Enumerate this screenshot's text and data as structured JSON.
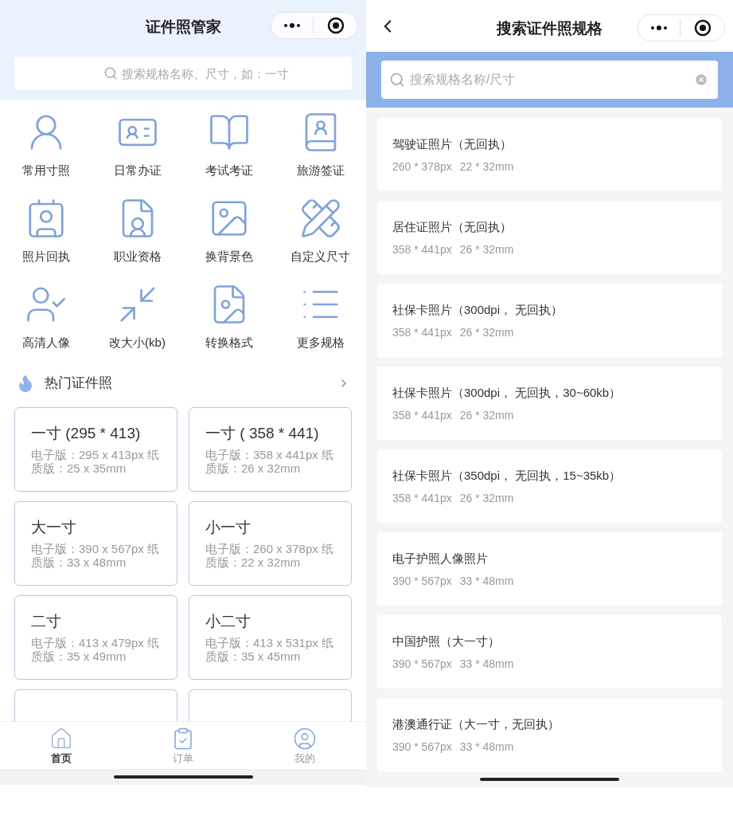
{
  "left": {
    "title": "证件照管家",
    "search": {
      "placeholder": "搜索规格名称、尺寸，如：一寸"
    },
    "shortcuts": [
      {
        "label": "常用寸照"
      },
      {
        "label": "日常办证"
      },
      {
        "label": "考试考证"
      },
      {
        "label": "旅游签证"
      },
      {
        "label": "照片回执"
      },
      {
        "label": "职业资格"
      },
      {
        "label": "换背景色"
      },
      {
        "label": "自定义尺寸"
      },
      {
        "label": "高清人像"
      },
      {
        "label": "改大小(kb)"
      },
      {
        "label": "转换格式"
      },
      {
        "label": "更多规格"
      }
    ],
    "hot": {
      "title": "热门证件照",
      "cards": [
        {
          "title": "一寸 (295 * 413)",
          "detail": "电子版：295 x 413px 纸质版：25 x 35mm"
        },
        {
          "title": "一寸 ( 358 * 441)",
          "detail": "电子版：358 x 441px 纸质版：26 x 32mm"
        },
        {
          "title": "大一寸",
          "detail": "电子版：390 x 567px 纸质版：33 x 48mm"
        },
        {
          "title": "小一寸",
          "detail": "电子版：260 x 378px 纸质版：22 x 32mm"
        },
        {
          "title": "二寸",
          "detail": "电子版：413 x 479px 纸质版：35 x 49mm"
        },
        {
          "title": "小二寸",
          "detail": "电子版：413 x 531px 纸质版：35 x 45mm"
        },
        {
          "kind": "cut_off"
        },
        {
          "kind": "cut_off"
        }
      ]
    },
    "tabs": [
      {
        "label": "首页",
        "selected": true
      },
      {
        "label": "订单",
        "selected": false
      },
      {
        "label": "我的",
        "selected": false
      }
    ]
  },
  "right": {
    "title": "搜索证件照规格",
    "search": {
      "placeholder": "搜索规格名称/尺寸"
    },
    "results": [
      {
        "name": "驾驶证照片（无回执）",
        "px": "260 * 378px",
        "mm": "22 * 32mm"
      },
      {
        "name": "居住证照片（无回执）",
        "px": "358 * 441px",
        "mm": "26 * 32mm"
      },
      {
        "name": "社保卡照片（300dpi， 无回执）",
        "px": "358 * 441px",
        "mm": "26 * 32mm"
      },
      {
        "name": "社保卡照片（300dpi， 无回执，30~60kb）",
        "px": "358 * 441px",
        "mm": "26 * 32mm"
      },
      {
        "name": "社保卡照片（350dpi， 无回执，15~35kb）",
        "px": "358 * 441px",
        "mm": "26 * 32mm"
      },
      {
        "name": "电子护照人像照片",
        "px": "390 * 567px",
        "mm": "33 * 48mm"
      },
      {
        "name": "中国护照（大一寸）",
        "px": "390 * 567px",
        "mm": "33 * 48mm"
      },
      {
        "name": "港澳通行证（大一寸，无回执）",
        "px": "390 * 567px",
        "mm": "33 * 48mm"
      }
    ]
  }
}
